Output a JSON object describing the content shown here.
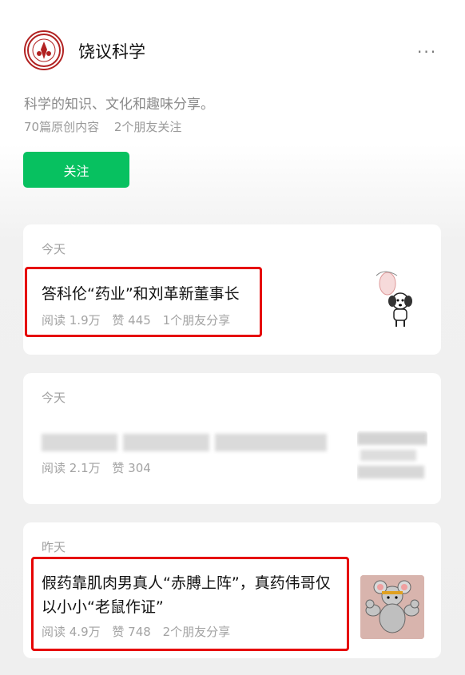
{
  "account": {
    "name": "饶议科学",
    "description": "科学的知识、文化和趣味分享。",
    "original_count": "70篇原创内容",
    "friends_following": "2个朋友关注",
    "follow_label": "关注",
    "more_label": "···"
  },
  "articles": [
    {
      "day": "今天",
      "title": "答科伦“药业”和刘革新董事长",
      "reads": "阅读 1.9万",
      "likes": "赞 445",
      "shares": "1个朋友分享"
    },
    {
      "day": "今天",
      "title": "",
      "reads": "阅读 2.1万",
      "likes": "赞 304",
      "shares": ""
    },
    {
      "day": "昨天",
      "title_line1": "假药靠肌肉男真人“赤膊上阵”，真药伟哥仅",
      "title_line2": "以小小“老鼠作证”",
      "reads": "阅读 4.9万",
      "likes": "赞 748",
      "shares": "2个朋友分享"
    }
  ],
  "colors": {
    "accent": "#07c160",
    "highlight": "#e60000"
  },
  "icons": [
    "account-logo",
    "more-icon",
    "dog-cartoon",
    "rat-bodybuilder"
  ]
}
